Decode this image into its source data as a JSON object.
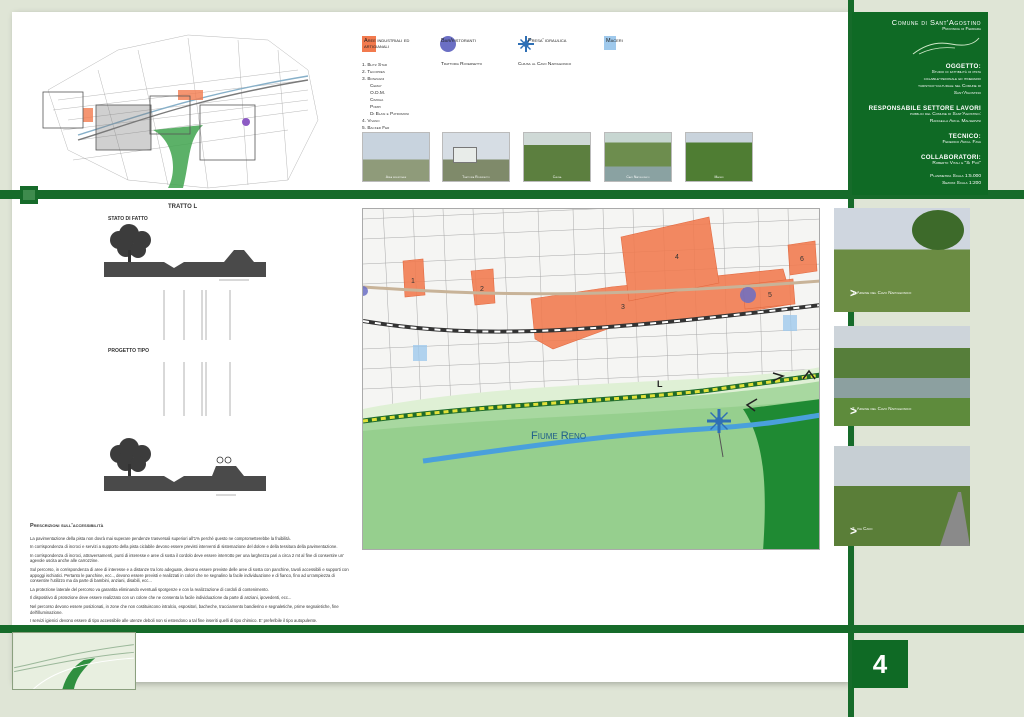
{
  "title_block": {
    "comune": "Comune di Sant'Agostino",
    "provincia": "Provincia di Ferrara",
    "oggetto_label": "OGGETTO:",
    "oggetto_text": [
      "Studio di fattibilità di pista",
      "ciclabile-pedonale ed itinerario",
      "turistico-culturale nel Comune di",
      "Sant'Agostino"
    ],
    "responsabile_label": "RESPONSABILE SETTORE LAVORI",
    "responsabile_text": [
      "pubblici del Comune di Sant'Agostino:",
      "Raffaella Arch. Malservisi"
    ],
    "tecnico_label": "TECNICO:",
    "tecnico_text": "Federico Arch. Fava",
    "collaboratori_label": "COLLABORATORI:",
    "collaboratori_text": "Roberto Vitali e \"Si Può\"",
    "scala1": "Planimetria Scala 1:5.000",
    "scala2": "Sezioni Scala     1:200",
    "sheet_number": "4"
  },
  "legend": {
    "industrial": "Aree industriali ed artigianali",
    "bar": "Bar/ristoranti",
    "presa": "Presa' idraulica",
    "maceri": "Maceri",
    "trattoria": "Trattoria Roversetto",
    "chiusa": "Chiusa al Cavo Napoleonico",
    "list": [
      "1. Blitz Star",
      "2. Tecopres",
      "3. Bonzagni",
      "Cemay",
      "O.D.M.",
      "Cimoha",
      "Pompi",
      "Di Blasi e Patromoni",
      "4. Vivano",
      "5. Backer Fer",
      "6. A.C.M."
    ]
  },
  "photos_top": [
    "Area industriale",
    "Trattoria Roversetto",
    "Chiusa",
    "Cavo Napoleonico",
    "Maceri"
  ],
  "tratto": {
    "title": "TRATTO L",
    "stato": "STATO DI FATTO",
    "progetto": "PROGETTO TIPO"
  },
  "notes": {
    "heading": "Prescrizioni sull'accessibilità",
    "paragraphs": [
      "La pavimentazione della pista non dovrà mai superare pendenze trasversali superiori all'1% perché questo ne comprometterebbe la fruibilità.",
      "In corrispondenza di incroci e servizi a supporto della pista ciclabile devono essere previsti interventi di sistemazione del dolore e della tessitura della pavimentazione.",
      "In corrispondenza di incroci, attraversamenti, punti di interesse e aree di sosta il cordolo deve essere interrotto per una larghezza pari a circa 2 mt al fine di consentire un' agevole uscita anche alle carrozzine.",
      "Sul percorso, in corrispondenza di aree di interesse e a distanze tra loro adeguate, devono essere previste delle aree di sosta con panchine, tavoli accessibili e supporti con appoggi ischiatici. Pertanto le panchine, ecc.., devono essere previsti e realizzati in colori che ne segnalino la facile individuazione e di fianco, fino ad un'ampiezza di consentire l'utilizzo ma da parte di bambini, anziani, disabili, ecc...",
      "La protezione laterale del percorso va garantita eliminando eventuali sporgenze e con la realizzazione di cordoli di contenimento.",
      "Il dispositivo di protezione deve essere realizzato con un colore che ne consenta la facile individuazione da parte di anziani, ipovedenti, ecc...",
      "Nel percorso devono essere posizionati, in zone che non costituiscono intralcio, espositori, bacheche, tracciamento bandierino e segnaletiche, prime segnaletiche, fine dell'illuminazione.",
      "I servizi igienici devono essere di tipo accessibile alle utenze deboli non si estendono a tal fine inseriti quelli di tipo chimico. E' preferibile il tipo autopulente."
    ]
  },
  "big_map": {
    "river": "Fiume Reno",
    "zones": [
      "1",
      "2",
      "3",
      "4",
      "5",
      "6"
    ],
    "tract": "L"
  },
  "right_photos": [
    "1. Argine del Cavo Napoleonico",
    "2. Argine del Cavo Napoleonico",
    "3. via Cavo"
  ],
  "colors": {
    "green": "#166b2a",
    "orange": "#f27a4e",
    "blue_circle": "#6b6fc4",
    "maceri": "#9fc9ec"
  }
}
